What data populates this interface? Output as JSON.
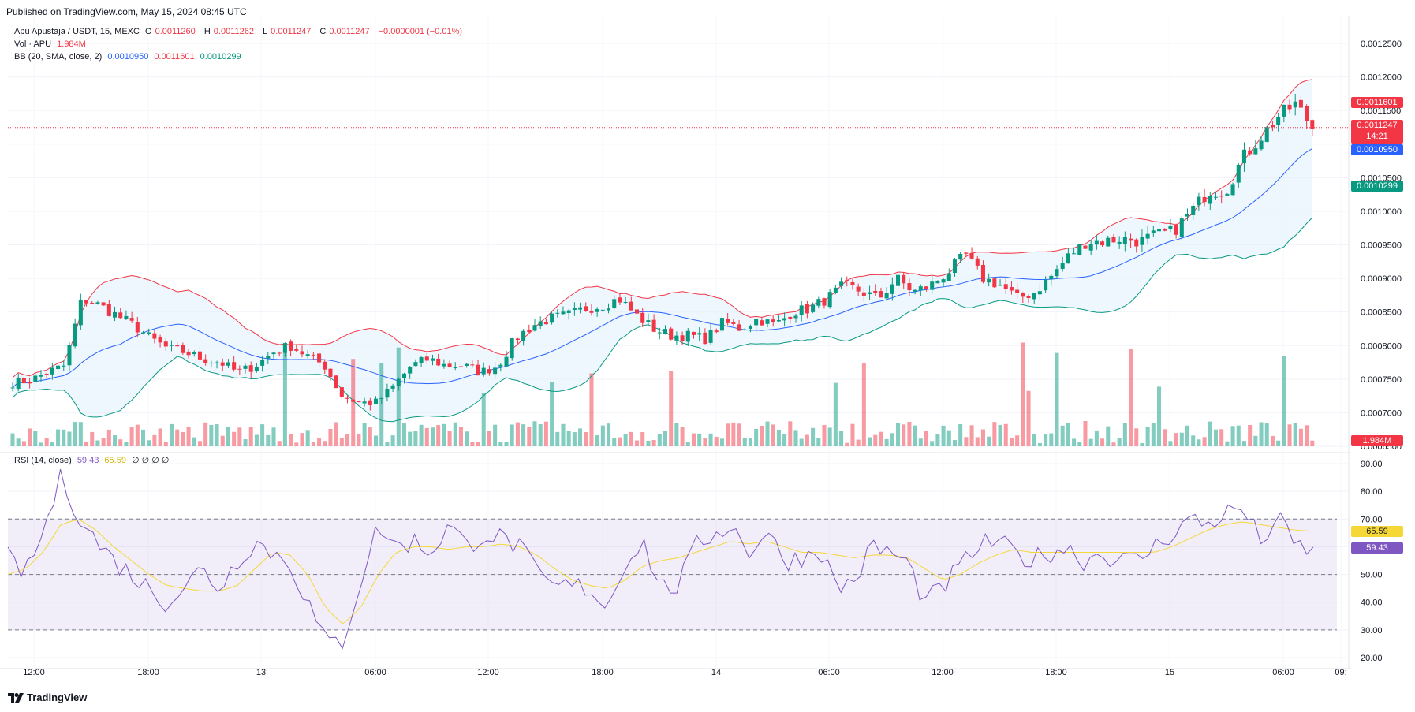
{
  "published": "Published on TradingView.com, May 15, 2024 08:45 UTC",
  "symbol": {
    "name": "Apu Apustaja / USDT, 15, MEXC",
    "o_label": "O",
    "o": "0.0011260",
    "h_label": "H",
    "h": "0.0011262",
    "l_label": "L",
    "l": "0.0011247",
    "c_label": "C",
    "c": "0.0011247",
    "change": "−0.0000001 (−0.01%)"
  },
  "volume_legend": {
    "label": "Vol · APU",
    "value": "1.984M"
  },
  "bb_legend": {
    "label": "BB (20, SMA, close, 2)",
    "basis": "0.0010950",
    "upper": "0.0011601",
    "lower": "0.0010299"
  },
  "rsi_legend": {
    "label": "RSI (14, close)",
    "rsi": "59.43",
    "ma": "65.59",
    "zeros": "∅ ∅ ∅ ∅"
  },
  "price_axis": [
    "0.0012500",
    "0.0012000",
    "0.0011500",
    "0.0011000",
    "0.0010500",
    "0.0010000",
    "0.0009500",
    "0.0009000",
    "0.0008500",
    "0.0008000",
    "0.0007500",
    "0.0007000",
    "0.0006500"
  ],
  "rsi_axis": [
    "90.00",
    "80.00",
    "70.00",
    "60.00",
    "50.00",
    "40.00",
    "30.00",
    "20.00"
  ],
  "time_axis": [
    "12:00",
    "18:00",
    "13",
    "06:00",
    "12:00",
    "18:00",
    "14",
    "06:00",
    "12:00",
    "18:00",
    "15",
    "06:00",
    "09:"
  ],
  "price_tags": {
    "upper": "0.0011601",
    "last": "0.0011247",
    "countdown": "14:21",
    "basis": "0.0010950",
    "lower": "0.0010299",
    "volume": "1.984M",
    "rsi_ma": "65.59",
    "rsi": "59.43"
  },
  "brand": "TradingView",
  "colors": {
    "up": "#089981",
    "down": "#f23645",
    "basis": "#2962ff",
    "rsi": "#7e57c2",
    "rsi_ma": "#f5d737",
    "band_fill": "#e3f2fd"
  },
  "chart_data": {
    "type": "candlestick",
    "timeframe": "15",
    "price_anchors": [
      0.000745,
      0.000748,
      0.00076,
      0.00077,
      0.00087,
      0.00086,
      0.000845,
      0.00083,
      0.00081,
      0.000795,
      0.00079,
      0.00078,
      0.000775,
      0.00076,
      0.00077,
      0.00079,
      0.0008,
      0.000785,
      0.00077,
      0.000725,
      0.000715,
      0.000715,
      0.00074,
      0.00077,
      0.00078,
      0.00077,
      0.00077,
      0.00076,
      0.00077,
      0.00081,
      0.00083,
      0.00084,
      0.000845,
      0.000855,
      0.00086,
      0.00087,
      0.000845,
      0.000825,
      0.000815,
      0.000815,
      0.00081,
      0.000835,
      0.000825,
      0.00084,
      0.00083,
      0.00085,
      0.000855,
      0.00087,
      0.00089,
      0.00088,
      0.00087,
      0.0009,
      0.00088,
      0.00089,
      0.00091,
      0.000935,
      0.0009,
      0.00089,
      0.00087,
      0.00088,
      0.000905,
      0.000935,
      0.000955,
      0.000955,
      0.00096,
      0.000955,
      0.000965,
      0.00097,
      0.001,
      0.00103,
      0.00103,
      0.00108,
      0.00111,
      0.00114,
      0.00116,
      0.001125
    ],
    "rsi_anchors": [
      56,
      50,
      65,
      85,
      72,
      62,
      55,
      50,
      45,
      40,
      46,
      52,
      45,
      55,
      62,
      58,
      54,
      40,
      25,
      26,
      48,
      68,
      60,
      62,
      58,
      68,
      60,
      65,
      63,
      60,
      50,
      45,
      46,
      45,
      38,
      55,
      62,
      45,
      46,
      60,
      65,
      68,
      58,
      66,
      55,
      56,
      60,
      45,
      48,
      60,
      58,
      54,
      40,
      45,
      53,
      60,
      62,
      58,
      55,
      58,
      60,
      55,
      58,
      55,
      55,
      60,
      65,
      70,
      68,
      72,
      74,
      62,
      70,
      60,
      59
    ],
    "rsi_ma_anchors": [
      50,
      52,
      58,
      68,
      70,
      66,
      60,
      55,
      50,
      46,
      45,
      44,
      44,
      46,
      52,
      58,
      57,
      50,
      38,
      32,
      38,
      50,
      58,
      60,
      60,
      59,
      60,
      60,
      61,
      60,
      57,
      52,
      48,
      46,
      45,
      48,
      53,
      55,
      56,
      58,
      60,
      62,
      61,
      62,
      60,
      58,
      58,
      57,
      56,
      57,
      57,
      56,
      52,
      48,
      50,
      54,
      57,
      59,
      58,
      58,
      58,
      58,
      58,
      58,
      58,
      58,
      60,
      63,
      66,
      68,
      69,
      68,
      67,
      66,
      65.59
    ]
  }
}
